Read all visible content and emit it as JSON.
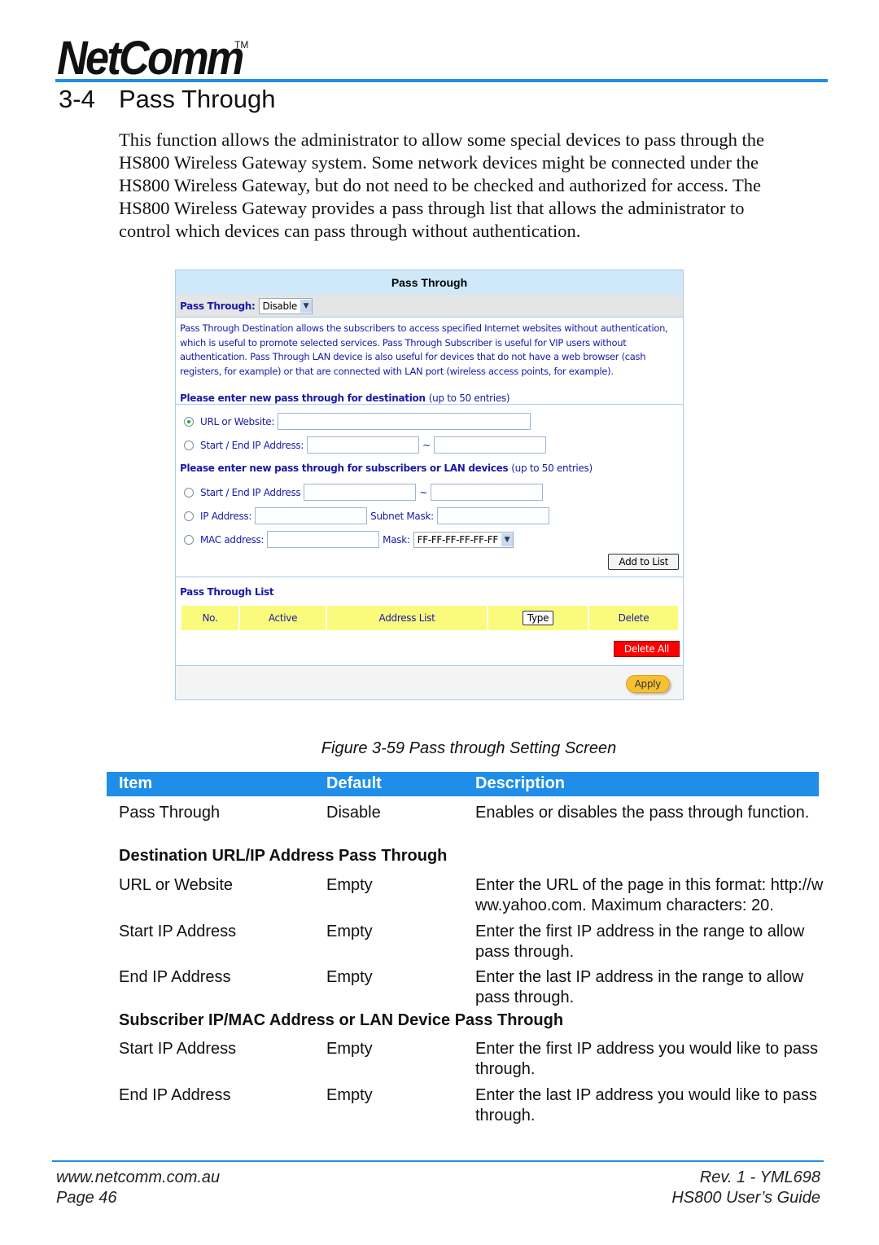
{
  "header": {
    "logo": "NetComm",
    "trademark": "TM",
    "section_number": "3-4",
    "section_title": "Pass Through"
  },
  "intro": "This function allows the administrator to allow some special devices to pass through the HS800 Wireless Gateway system. Some network devices might be connected under the HS800 Wireless Gateway, but do not need to be checked and authorized for access. The HS800 Wireless Gateway provides a pass through list that allows the administrator to control which devices can pass through without authentication.",
  "ui": {
    "title": "Pass Through",
    "pass_through_label": "Pass Through:",
    "pass_through_value": "Disable",
    "description": "Pass Through Destination allows the subscribers to access specified Internet websites without authentication, which is useful to promote selected services. Pass Through Subscriber is useful for VIP users without authentication. Pass Through LAN device is also useful for devices that do not have a web browser (cash registers, for example) or that are connected with LAN port (wireless access points, for example).",
    "dest_heading": "Please enter new pass through for destination",
    "dest_note": "(up to 50 entries)",
    "url_label": "URL or Website:",
    "start_end_label": "Start / End IP Address:",
    "tilde": "~",
    "sub_heading": "Please enter new pass through for subscribers or LAN devices",
    "sub_note": "(up to 50 entries)",
    "sub_start_end_label": "Start / End IP Address",
    "ip_label": "IP Address:",
    "subnet_label": "Subnet Mask:",
    "mac_label": "MAC address:",
    "mask_label": "Mask:",
    "mask_value": "FF-FF-FF-FF-FF-FF",
    "add_button": "Add to List",
    "list_heading": "Pass Through List",
    "columns": [
      "No.",
      "Active",
      "Address List",
      "Type",
      "Delete"
    ],
    "delete_all": "Delete All",
    "apply": "Apply"
  },
  "caption": "Figure 3-59 Pass through Setting Screen",
  "table": {
    "headers": [
      "Item",
      "Default",
      "Description"
    ],
    "rows": [
      {
        "item": "Pass Through",
        "default": "Disable",
        "description": "Enables or disables the pass through function."
      }
    ],
    "section1": "Destination URL/IP Address Pass Through",
    "rows1": [
      {
        "item": "URL or Website",
        "default": "Empty",
        "description": "Enter the URL of the page in this format: http://www.yahoo.com. Maximum characters: 20."
      },
      {
        "item": "Start IP Address",
        "default": "Empty",
        "description": "Enter the first IP address in the range to allow pass through."
      },
      {
        "item": "End IP Address",
        "default": "Empty",
        "description": "Enter the last IP address in the range to allow pass through."
      }
    ],
    "section2": "Subscriber IP/MAC Address or LAN Device Pass Through",
    "rows2": [
      {
        "item": "Start IP Address",
        "default": "Empty",
        "description": "Enter the first IP address you would like to pass through."
      },
      {
        "item": "End IP Address",
        "default": "Empty",
        "description": "Enter the last IP address you would like to pass through."
      }
    ]
  },
  "footer": {
    "website": "www.netcomm.com.au",
    "page": "Page 46",
    "rev": "Rev. 1 - YML698",
    "guide": "HS800 User’s Guide"
  }
}
